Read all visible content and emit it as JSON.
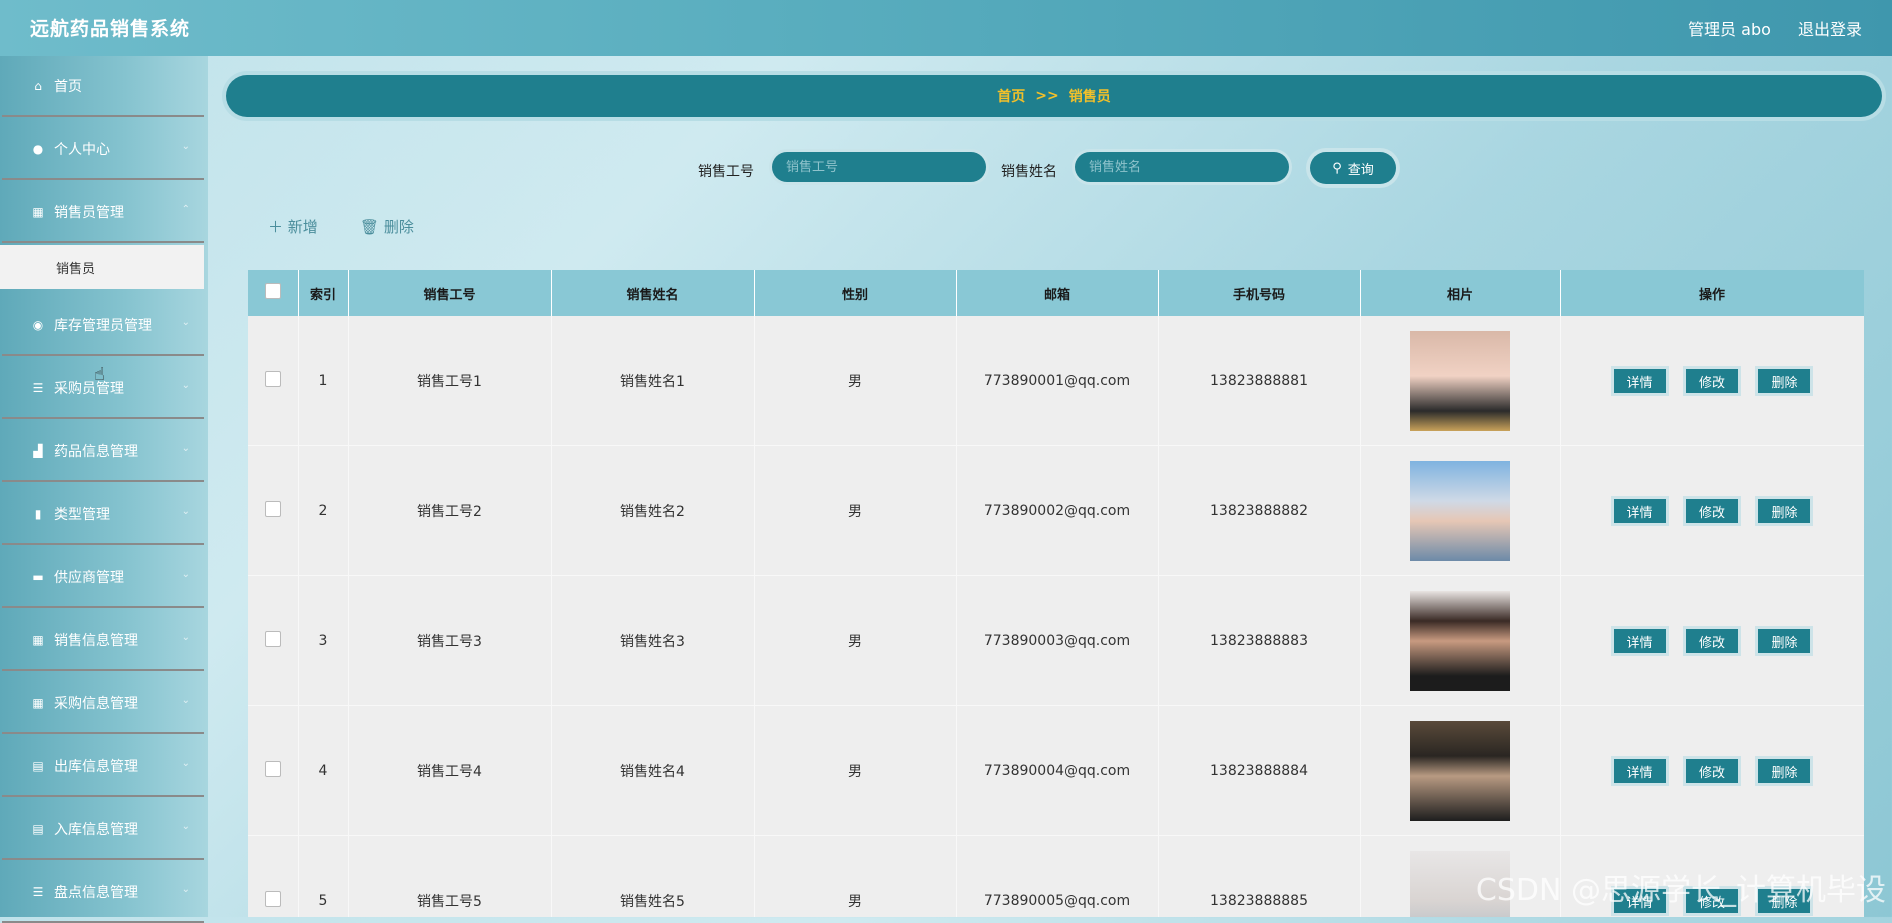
{
  "header": {
    "app_title": "远航药品销售系统",
    "user_label": "管理员 abo",
    "logout_label": "退出登录"
  },
  "sidebar": {
    "items": [
      {
        "label": "首页",
        "icon": "home-icon"
      },
      {
        "label": "个人中心",
        "icon": "user-icon"
      },
      {
        "label": "销售员管理",
        "icon": "grid-icon"
      },
      {
        "label": "库存管理员管理",
        "icon": "location-icon"
      },
      {
        "label": "采购员管理",
        "icon": "list-icon"
      },
      {
        "label": "药品信息管理",
        "icon": "thumb-icon"
      },
      {
        "label": "类型管理",
        "icon": "bar-chart-icon"
      },
      {
        "label": "供应商管理",
        "icon": "briefcase-icon"
      },
      {
        "label": "销售信息管理",
        "icon": "grid-icon"
      },
      {
        "label": "采购信息管理",
        "icon": "grid-icon"
      },
      {
        "label": "出库信息管理",
        "icon": "clipboard-icon"
      },
      {
        "label": "入库信息管理",
        "icon": "clipboard-icon"
      },
      {
        "label": "盘点信息管理",
        "icon": "list-icon"
      }
    ],
    "sub_item": "销售员"
  },
  "breadcrumb": {
    "home": "首页",
    "sep": ">>",
    "current": "销售员"
  },
  "search": {
    "label_1": "销售工号",
    "placeholder_1": "销售工号",
    "label_2": "销售姓名",
    "placeholder_2": "销售姓名",
    "button": "查询"
  },
  "actions": {
    "add": "新增",
    "delete": "删除"
  },
  "table": {
    "headers": [
      "索引",
      "销售工号",
      "销售姓名",
      "性别",
      "邮箱",
      "手机号码",
      "相片",
      "操作"
    ],
    "rows": [
      {
        "index": "1",
        "id": "销售工号1",
        "name": "销售姓名1",
        "gender": "男",
        "email": "773890001@qq.com",
        "phone": "13823888881"
      },
      {
        "index": "2",
        "id": "销售工号2",
        "name": "销售姓名2",
        "gender": "男",
        "email": "773890002@qq.com",
        "phone": "13823888882"
      },
      {
        "index": "3",
        "id": "销售工号3",
        "name": "销售姓名3",
        "gender": "男",
        "email": "773890003@qq.com",
        "phone": "13823888883"
      },
      {
        "index": "4",
        "id": "销售工号4",
        "name": "销售姓名4",
        "gender": "男",
        "email": "773890004@qq.com",
        "phone": "13823888884"
      },
      {
        "index": "5",
        "id": "销售工号5",
        "name": "销售姓名5",
        "gender": "男",
        "email": "773890005@qq.com",
        "phone": "13823888885"
      }
    ],
    "op_labels": {
      "detail": "详情",
      "edit": "修改",
      "remove": "删除"
    }
  },
  "watermark": "CSDN @思源学长_计算机毕设",
  "colors": {
    "accent": "#1f7f8e",
    "breadcrumb_text": "#f2c02a",
    "header_bg": "#89c8d5"
  }
}
